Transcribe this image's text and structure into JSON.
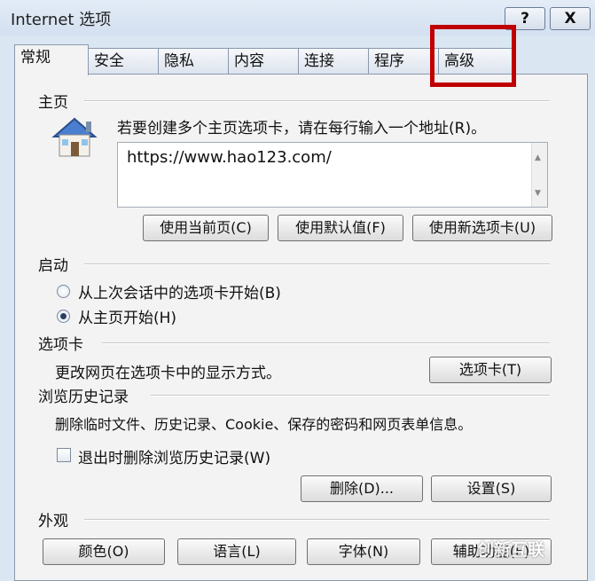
{
  "window": {
    "title": "Internet 选项",
    "help": "?",
    "close": "X"
  },
  "tabs": [
    "常规",
    "安全",
    "隐私",
    "内容",
    "连接",
    "程序",
    "高级"
  ],
  "home": {
    "section": "主页",
    "instruction": "若要创建多个主页选项卡，请在每行输入一个地址(R)。",
    "url": "https://www.hao123.com/",
    "buttons": [
      "使用当前页(C)",
      "使用默认值(F)",
      "使用新选项卡(U)"
    ]
  },
  "startup": {
    "section": "启动",
    "options": [
      "从上次会话中的选项卡开始(B)",
      "从主页开始(H)"
    ],
    "selected": 1
  },
  "tabs_section": {
    "section": "选项卡",
    "desc": "更改网页在选项卡中的显示方式。",
    "button": "选项卡(T)"
  },
  "history": {
    "section": "浏览历史记录",
    "desc": "删除临时文件、历史记录、Cookie、保存的密码和网页表单信息。",
    "checkbox": "退出时删除浏览历史记录(W)",
    "delete_btn": "删除(D)...",
    "settings_btn": "设置(S)"
  },
  "appearance": {
    "section": "外观",
    "buttons": [
      "颜色(O)",
      "语言(L)",
      "字体(N)",
      "辅助功能(E)"
    ]
  },
  "watermark": "创新互联",
  "colors": {
    "highlight": "#c00000",
    "window_bg": "#dbe6f3",
    "panel_bg": "#f3f3f3"
  }
}
